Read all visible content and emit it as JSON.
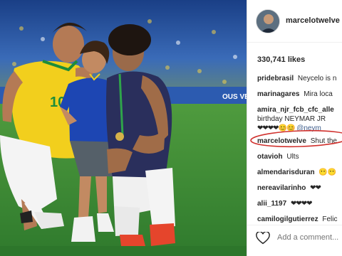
{
  "post": {
    "username": "marcelotwelve",
    "likes": "330,741 likes"
  },
  "comments": [
    {
      "user": "pridebrasil",
      "text": "Neycelo is n"
    },
    {
      "user": "marinagares",
      "text": "Mira loca"
    },
    {
      "user": "amira_njr_fcb_cfc_alle",
      "text_line2": "birthday NEYMAR JR",
      "text_line3": "❤❤❤❤😊😊",
      "mention": "@neym"
    },
    {
      "user": "marcelotwelve",
      "text": "Shut the"
    },
    {
      "user": "otavioh",
      "text": "Ults"
    },
    {
      "user": "almendarisduran",
      "text": "😶😶"
    },
    {
      "user": "nereavilarinho",
      "text": "❤❤"
    },
    {
      "user": "alii_1197",
      "text": "❤❤❤❤"
    },
    {
      "user": "camilogilgutierrez",
      "text": "Felic"
    }
  ],
  "footer": {
    "add_comment_placeholder": "Add a comment..."
  },
  "photo": {
    "jersey_number": "10",
    "ad_board_text": "OUS VENA"
  },
  "colors": {
    "highlight_ellipse": "#d0312d",
    "pitch": "#3d8a3a",
    "brazil_yellow": "#f5d020",
    "brazil_blue": "#1f3f9a"
  }
}
